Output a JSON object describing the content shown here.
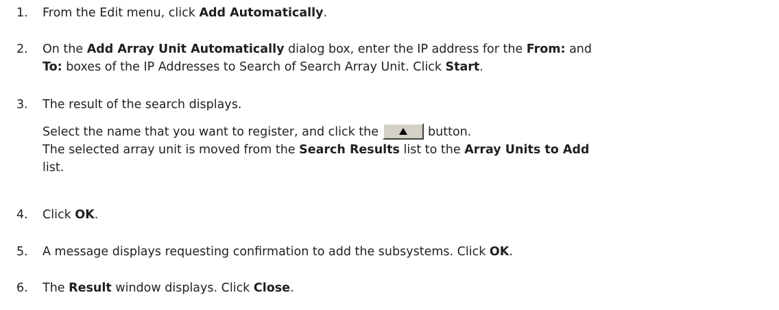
{
  "steps": [
    {
      "number": "1.",
      "a": "From the Edit menu, click ",
      "b": "Add Automatically",
      "c": "."
    },
    {
      "number": "2.",
      "line1": {
        "a": "On the ",
        "b": "Add Array Unit Automatically",
        "c": " dialog box, enter the IP address for the ",
        "d": "From:",
        "e": " and"
      },
      "line2": {
        "a": "To:",
        "b": " boxes of the IP Addresses to Search of Search Array Unit. Click ",
        "c": "Start",
        "d": "."
      }
    },
    {
      "number": "3.",
      "line1": "The result of the search displays.",
      "line2": {
        "a": "Select the name that you want to register, and click the",
        "b": "button."
      },
      "line3": {
        "a": "The selected array unit is moved from the ",
        "b": "Search Results",
        "c": " list to the ",
        "d": "Array Units to Add"
      },
      "line4": "list."
    },
    {
      "number": "4.",
      "a": "Click ",
      "b": "OK",
      "c": "."
    },
    {
      "number": "5.",
      "a": "A message displays requesting confirmation to add the subsystems. Click ",
      "b": "OK",
      "c": "."
    },
    {
      "number": "6.",
      "a": "The ",
      "b": "Result",
      "c": " window displays. Click ",
      "d": "Close",
      "e": "."
    }
  ],
  "icons": {
    "move_up_button": "up-triangle-icon"
  }
}
